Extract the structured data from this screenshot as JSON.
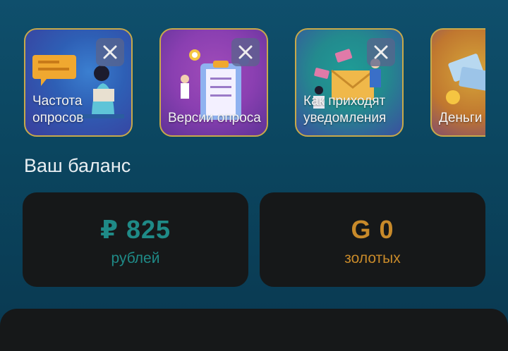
{
  "colors": {
    "rub_accent": "#1f8a87",
    "gold_accent": "#c88a2a",
    "card_bg": "#161819",
    "story_border": "#c8a94a"
  },
  "stories": [
    {
      "label": "Частота опросов",
      "icon": "close-icon"
    },
    {
      "label": "Версии опроса",
      "icon": "close-icon"
    },
    {
      "label": "Как приходят уведомления",
      "icon": "close-icon"
    },
    {
      "label": "Деньги призы",
      "icon": ""
    }
  ],
  "balance": {
    "title": "Ваш баланс",
    "rub": {
      "amount": "₽ 825",
      "unit": "рублей"
    },
    "gold": {
      "amount": "G 0",
      "unit": "золотых"
    }
  }
}
